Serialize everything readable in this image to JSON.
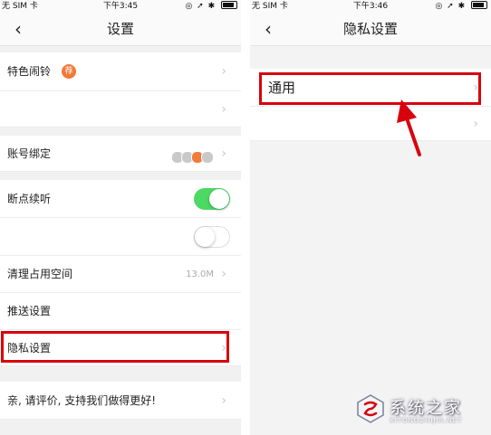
{
  "left_screen": {
    "status": {
      "carrier": "无 SIM 卡",
      "time": "下午3:45",
      "battery_icon": "battery-icon"
    },
    "nav": {
      "back": "‹",
      "title": "设置"
    },
    "rows": {
      "alarm": {
        "label": "特色闹铃",
        "badge": "荐"
      },
      "account": {
        "label": "账号绑定"
      },
      "resume": {
        "label": "断点续听",
        "toggle": "on"
      },
      "toggle2": {
        "toggle": "off"
      },
      "clear": {
        "label": "清理占用空间",
        "value": "13.0M"
      },
      "push": {
        "label": "推送设置"
      },
      "privacy": {
        "label": "隐私设置"
      },
      "rate": {
        "label": "亲, 请评价, 支持我们做得更好!"
      }
    },
    "chevron": "›"
  },
  "right_screen": {
    "status": {
      "carrier": "无 SIM 卡",
      "time": "下午3:46"
    },
    "nav": {
      "back": "‹",
      "title": "隐私设置"
    },
    "rows": {
      "general": {
        "label": "通用"
      }
    },
    "chevron": "›"
  },
  "watermark": {
    "text": "系统之家",
    "sub": "XITONGZHIJIA.NET"
  },
  "colors": {
    "highlight": "#d8000c",
    "toggle_on": "#4cd964",
    "badge": "#f27a3a"
  }
}
